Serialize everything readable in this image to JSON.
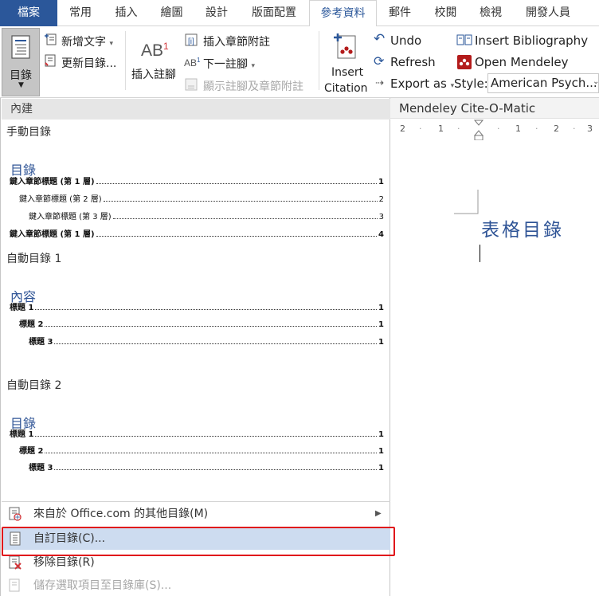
{
  "tabs": [
    "檔案",
    "常用",
    "插入",
    "繪圖",
    "設計",
    "版面配置",
    "參考資料",
    "郵件",
    "校閱",
    "檢視",
    "開發人員"
  ],
  "ribbon": {
    "toc_button": "目錄",
    "add_text": "新增文字",
    "update_toc": "更新目錄...",
    "insert_footnote": "插入註腳",
    "insert_endnote": "插入章節附註",
    "next_footnote": "下一註腳",
    "show_notes": "顯示註腳及章節附註",
    "insert_citation_1": "Insert",
    "insert_citation_2": "Citation",
    "undo": "Undo",
    "refresh": "Refresh",
    "export_as": "Export as",
    "insert_bibliography": "Insert Bibliography",
    "open_mendeley": "Open Mendeley",
    "style_label": "Style:",
    "style_value": "American Psych..."
  },
  "pane_header": "Mendeley Cite-O-Matic",
  "ruler_marks": [
    "2",
    "1",
    "1",
    "2",
    "3"
  ],
  "document": {
    "heading": "表格目錄"
  },
  "menu": {
    "section_header": "內建",
    "galleries": [
      {
        "label": "手動目錄",
        "heading": "目錄",
        "lines": [
          {
            "text": "鍵入章節標題 (第 1 層)",
            "page": "1"
          },
          {
            "text": "鍵入章節標題 (第 2 層)",
            "page": "2"
          },
          {
            "text": "鍵入章節標題 (第 3 層)",
            "page": "3"
          },
          {
            "text": "鍵入章節標題 (第 1 層)",
            "page": "4"
          }
        ]
      },
      {
        "label": "自動目錄 1",
        "heading": "內容",
        "lines": [
          {
            "text": "標題 1",
            "page": "1"
          },
          {
            "text": "標題 2",
            "page": "1"
          },
          {
            "text": "標題 3",
            "page": "1"
          }
        ]
      },
      {
        "label": "自動目錄 2",
        "heading": "目錄",
        "lines": [
          {
            "text": "標題 1",
            "page": "1"
          },
          {
            "text": "標題 2",
            "page": "1"
          },
          {
            "text": "標題 3",
            "page": "1"
          }
        ]
      }
    ],
    "items": [
      {
        "label": "來自於 Office.com 的其他目錄(M)",
        "icon": "office-toc-icon"
      },
      {
        "label": "自訂目錄(C)...",
        "icon": "custom-toc-icon"
      },
      {
        "label": "移除目錄(R)",
        "icon": "remove-toc-icon"
      },
      {
        "label": "儲存選取項目至目錄庫(S)...",
        "icon": "save-selection-icon"
      }
    ]
  },
  "colors": {
    "file_tab": "#2b579a",
    "heading_blue": "#2f5496",
    "highlight_red": "#e0161b",
    "hover_blue": "#cddcf0",
    "mendeley_red": "#b31b1b"
  }
}
